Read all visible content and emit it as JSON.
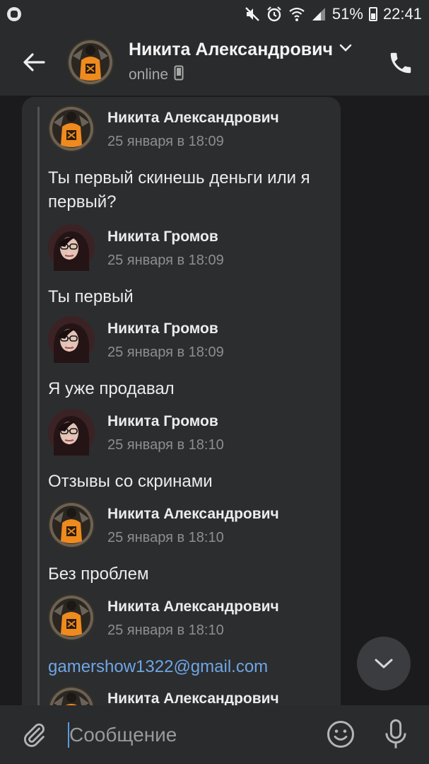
{
  "status_bar": {
    "battery": "51%",
    "time": "22:41",
    "icons": [
      "app-icon",
      "mute-icon",
      "alarm-icon",
      "wifi-icon",
      "signal-icon",
      "battery-icon"
    ]
  },
  "header": {
    "name": "Никита Александрович",
    "status": "online",
    "icons": [
      "back-arrow-icon",
      "chevron-down-icon",
      "phone-device-icon",
      "phone-call-icon"
    ]
  },
  "messages": [
    {
      "author": "Никита Александрович",
      "date": "25 января в 18:09",
      "text": "Ты первый скинешь деньги или я первый?",
      "avatar": "orange"
    },
    {
      "author": "Никита Громов",
      "date": "25 января в 18:09",
      "text": "Ты первый",
      "avatar": "girl"
    },
    {
      "author": "Никита Громов",
      "date": "25 января в 18:09",
      "text": "Я уже продавал",
      "avatar": "girl"
    },
    {
      "author": "Никита Громов",
      "date": "25 января в 18:10",
      "text": "Отзывы со скринами",
      "avatar": "girl"
    },
    {
      "author": "Никита Александрович",
      "date": "25 января в 18:10",
      "text": "Без проблем",
      "avatar": "orange"
    },
    {
      "author": "Никита Александрович",
      "date": "25 января в 18:10",
      "text": "gamershow1322@gmail.com",
      "avatar": "orange",
      "is_link": true
    },
    {
      "author": "Никита Александрович",
      "date": "",
      "text": "",
      "avatar": "orange"
    }
  ],
  "composer": {
    "placeholder": "Сообщение",
    "icons": [
      "attach-icon",
      "emoji-icon",
      "mic-icon"
    ]
  },
  "colors": {
    "background": "#1b1b1d",
    "bar": "#2a2b2d",
    "bubble": "#2c2d2f",
    "link": "#6ea6e6",
    "avatar_orange": "#ef8a1e"
  }
}
